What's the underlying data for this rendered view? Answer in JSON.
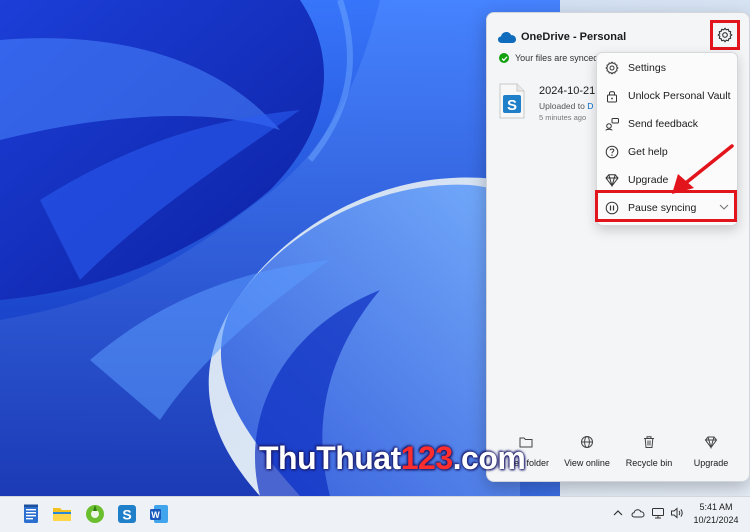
{
  "onedrive": {
    "title": "OneDrive - Personal",
    "status": "Your files are synced",
    "activity": {
      "file_name": "2024-10-21,",
      "uploaded_prefix": "Uploaded to",
      "uploaded_link": "D",
      "time": "5 minutes ago"
    }
  },
  "menu": {
    "items": [
      {
        "label": "Settings",
        "icon": "gear-icon"
      },
      {
        "label": "Unlock Personal Vault",
        "icon": "lock-icon"
      },
      {
        "label": "Send feedback",
        "icon": "feedback-icon"
      },
      {
        "label": "Get help",
        "icon": "help-icon"
      },
      {
        "label": "Upgrade",
        "icon": "diamond-icon"
      },
      {
        "label": "Pause syncing",
        "icon": "pause-icon"
      }
    ]
  },
  "footer": {
    "open_folder": "en folder",
    "view_online": "View online",
    "recycle_bin": "Recycle bin",
    "upgrade": "Upgrade"
  },
  "watermark": {
    "part1": "ThuThuat",
    "part2": "123",
    "part3": ".com"
  },
  "taskbar": {
    "apps": [
      "notepad-icon",
      "file-explorer-icon",
      "greenshot-icon",
      "snagit-icon",
      "word-icon"
    ],
    "time": "5:41 AM",
    "date": "10/21/2024"
  },
  "colors": {
    "highlight": "#e2141c",
    "onedrive_blue": "#0f6cbd",
    "sync_green": "#13a10e"
  }
}
